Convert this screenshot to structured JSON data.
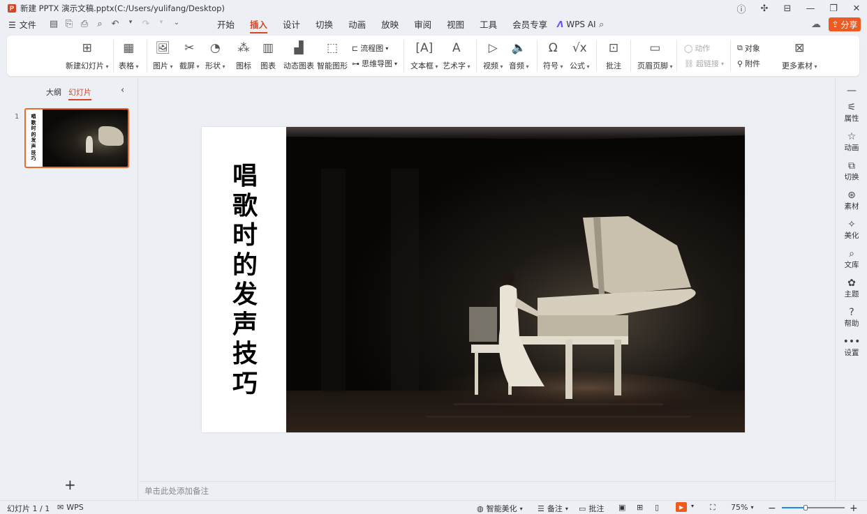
{
  "window": {
    "logo_letter": "P",
    "title": "新建 PPTX 演示文稿.pptx(C:/Users/yulifang/Desktop)",
    "controls": [
      "ⓘ",
      "✕",
      "⌂",
      "—",
      "❐",
      "✕"
    ]
  },
  "menu": {
    "file_label": "文件",
    "tabs": [
      "开始",
      "插入",
      "设计",
      "切换",
      "动画",
      "放映",
      "审阅",
      "视图",
      "工具",
      "会员专享"
    ],
    "active_tab": "插入",
    "wps_ai_label": "WPS AI",
    "share_label": "分享"
  },
  "ribbon": {
    "new_slide": "新建幻灯片",
    "table": "表格",
    "picture": "图片",
    "screenshot": "截屏",
    "shape": "形状",
    "icon": "图标",
    "chart": "图表",
    "dynamic_chart": "动态图表",
    "smart_graphic": "智能图形",
    "flowchart": "流程图",
    "mindmap": "思维导图",
    "textbox": "文本框",
    "wordart": "艺术字",
    "video": "视频",
    "audio": "音频",
    "symbol": "符号",
    "formula": "公式",
    "comment": "批注",
    "header_footer": "页眉页脚",
    "action": "动作",
    "hyperlink": "超链接",
    "object": "对象",
    "attachment": "附件",
    "more_assets": "更多素材"
  },
  "left_pane": {
    "tab_outline": "大纲",
    "tab_slides": "幻灯片",
    "slide_number": "1",
    "thumb_title": "唱歌时的发声技巧"
  },
  "slide": {
    "title": "唱歌时的发声技巧"
  },
  "notes": {
    "placeholder": "单击此处添加备注"
  },
  "right_sidebar": [
    {
      "icon": "properties-icon",
      "label": "属性"
    },
    {
      "icon": "animation-icon",
      "label": "动画"
    },
    {
      "icon": "transition-icon",
      "label": "切换"
    },
    {
      "icon": "assets-icon",
      "label": "素材"
    },
    {
      "icon": "beautify-icon",
      "label": "美化"
    },
    {
      "icon": "library-icon",
      "label": "文库"
    },
    {
      "icon": "theme-icon",
      "label": "主题"
    },
    {
      "icon": "help-icon",
      "label": "帮助"
    },
    {
      "icon": "settings-icon",
      "label": "设置"
    }
  ],
  "status": {
    "slide_info": "幻灯片 1 / 1",
    "wps_label": "WPS",
    "smart_beautify": "智能美化",
    "notes": "备注",
    "comments": "批注",
    "zoom": "75%",
    "zoom_fraction": 0.38
  },
  "colors": {
    "accent": "#d24726",
    "share": "#ed5b23"
  }
}
